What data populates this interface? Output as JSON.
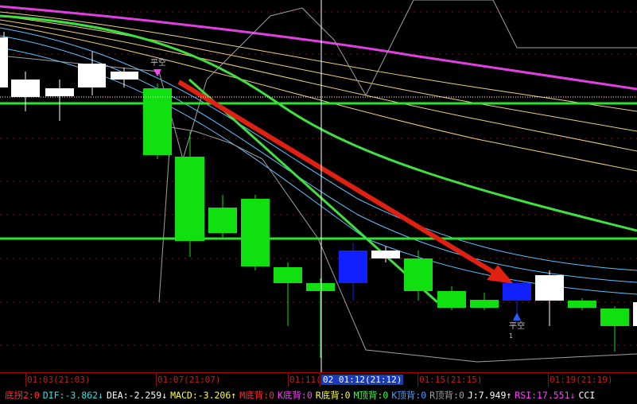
{
  "chart_data": {
    "type": "candlestick",
    "candles": [
      {
        "open": 7.3,
        "high": 8.3,
        "low": 6.6,
        "close": 7.9,
        "color": "white"
      },
      {
        "open": 6.6,
        "high": 7.1,
        "low": 5.9,
        "close": 7.2,
        "color": "white"
      },
      {
        "open": 6.5,
        "high": 6.8,
        "low": 5.8,
        "close": 6.9,
        "color": "white"
      },
      {
        "open": 6.9,
        "high": 8.2,
        "low": 6.5,
        "close": 7.8,
        "color": "white"
      },
      {
        "open": 7.2,
        "high": 7.6,
        "low": 6.9,
        "close": 7.5,
        "color": "white"
      },
      {
        "open": 6.9,
        "high": 7.2,
        "low": 4.8,
        "close": 4.8,
        "color": "green"
      },
      {
        "open": 4.6,
        "high": 5.0,
        "low": 2.2,
        "close": 2.7,
        "color": "green"
      },
      {
        "open": 3.6,
        "high": 4.4,
        "low": 2.7,
        "close": 2.8,
        "color": "green"
      },
      {
        "open": 3.7,
        "high": 3.8,
        "low": 1.9,
        "close": 1.9,
        "color": "green"
      },
      {
        "open": 1.6,
        "high": 1.6,
        "low": 0.0,
        "close": 1.0,
        "color": "green"
      },
      {
        "open": 1.1,
        "high": 1.4,
        "low": 0.4,
        "close": 0.8,
        "color": "green"
      },
      {
        "open": 1.8,
        "high": 2.2,
        "low": 0.6,
        "close": 1.1,
        "color": "blue"
      },
      {
        "open": 1.9,
        "high": 2.1,
        "low": 1.7,
        "close": 2.2,
        "color": "white"
      },
      {
        "open": 2.0,
        "high": 2.3,
        "low": 0.8,
        "close": 1.1,
        "color": "green"
      },
      {
        "open": 0.8,
        "high": 0.8,
        "low": 0.4,
        "close": 0.4,
        "color": "green"
      },
      {
        "open": 0.6,
        "high": 0.9,
        "low": 0.5,
        "close": 0.4,
        "color": "green"
      },
      {
        "open": 1.2,
        "high": 1.6,
        "low": 0.3,
        "close": 0.7,
        "color": "blue"
      },
      {
        "open": 0.8,
        "high": 1.3,
        "low": 0.7,
        "close": 1.3,
        "color": "white"
      },
      {
        "open": 0.6,
        "high": 0.6,
        "low": 0.3,
        "close": 0.4,
        "color": "green"
      },
      {
        "open": 0.3,
        "high": 0.3,
        "low": -0.5,
        "close": -0.2,
        "color": "green"
      },
      {
        "open": 0.1,
        "high": 0.6,
        "low": -0.1,
        "close": 0.6,
        "color": "white"
      }
    ],
    "annotations": [
      {
        "text": "平空",
        "candle_index": 4,
        "marker": "pink-triangle-down"
      },
      {
        "text": "平空",
        "candle_index": 16,
        "marker": "blue-triangle-up"
      },
      {
        "text": "1",
        "candle_index": 16
      }
    ],
    "reference_levels": [
      6.3,
      3.2
    ],
    "x_labels": [
      "01:03(21:03)",
      "01:07(21:07)",
      "01:11(",
      "02 01:12(21:12)",
      "01:15(21:15)",
      "01:19(21:19)"
    ]
  },
  "status_bar": [
    {
      "text": "底拐2:0",
      "color": "#ff3030"
    },
    {
      "text": "DIF:-3.862↓",
      "color": "#30e0e0"
    },
    {
      "text": "DEA:-2.259↓",
      "color": "#ffffff"
    },
    {
      "text": "MACD:-3.206↑",
      "color": "#ffff40"
    },
    {
      "text": "M底背:0",
      "color": "#ff3030"
    },
    {
      "text": "K底背:0",
      "color": "#ff40ff"
    },
    {
      "text": "R底背:0",
      "color": "#ffff40"
    },
    {
      "text": "M顶背:0",
      "color": "#40ff40"
    },
    {
      "text": "K顶背:0",
      "color": "#4fa0ff"
    },
    {
      "text": "R顶背:0",
      "color": "#a0a0a0"
    },
    {
      "text": "J:7.949↑",
      "color": "#ffffff"
    },
    {
      "text": "RSI:17.551↓",
      "color": "#ff40ff"
    },
    {
      "text": "CCI",
      "color": "#ffffff"
    }
  ]
}
